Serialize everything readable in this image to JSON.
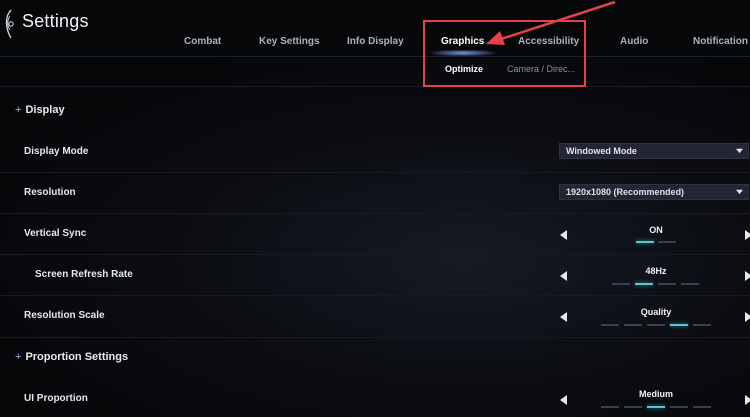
{
  "header": {
    "title": "Settings",
    "tabs": [
      "Combat",
      "Key Settings",
      "Info Display",
      "Graphics",
      "Accessibility",
      "Audio",
      "Notification"
    ],
    "active_tab": "Graphics",
    "subtabs": [
      "Optimize",
      "Camera / Direc..."
    ],
    "active_subtab": "Optimize"
  },
  "sections": {
    "display": "Display",
    "proportion": "Proportion Settings"
  },
  "rows": {
    "display_mode": {
      "label": "Display Mode",
      "value": "Windowed Mode"
    },
    "resolution": {
      "label": "Resolution",
      "value": "1920x1080 (Recommended)"
    },
    "vertical_sync": {
      "label": "Vertical Sync",
      "value": "ON",
      "steps": 2,
      "selected_step": 1
    },
    "screen_refresh_rate": {
      "label": "Screen Refresh Rate",
      "value": "48Hz",
      "steps": 4,
      "selected_step": 2
    },
    "resolution_scale": {
      "label": "Resolution Scale",
      "value": "Quality",
      "steps": 5,
      "selected_step": 4
    },
    "ui_proportion": {
      "label": "UI Proportion",
      "value": "Medium",
      "steps": 5,
      "selected_step": 3
    }
  },
  "colors": {
    "accent": "#59c7d3",
    "annotation": "#e2434a",
    "background": "#0b0d12"
  }
}
